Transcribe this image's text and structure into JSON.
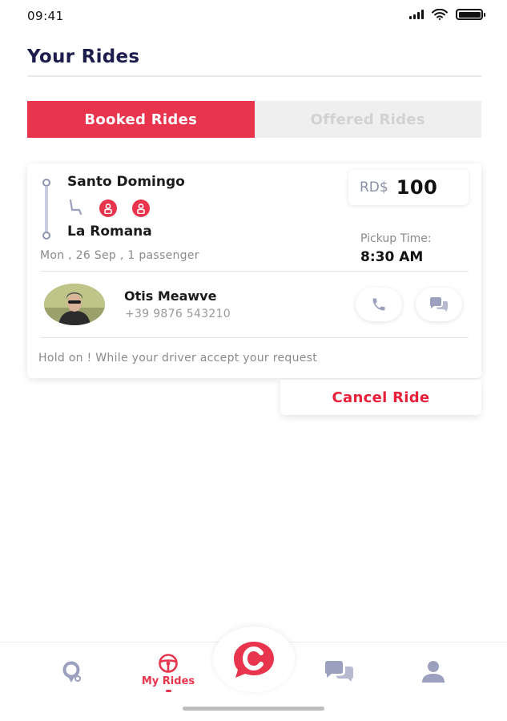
{
  "status_bar": {
    "time": "09:41"
  },
  "header": {
    "title": "Your Rides"
  },
  "tabs": [
    {
      "label": "Booked Rides",
      "active": true
    },
    {
      "label": "Offered Rides",
      "active": false
    }
  ],
  "ride": {
    "origin": "Santo Domingo",
    "destination": "La Romana",
    "currency": "RD$",
    "price": "100",
    "pickup_label": "Pickup Time:",
    "pickup_time": "8:30 AM",
    "meta": "Mon , 26 Sep , 1 passenger",
    "seats_booked": 2,
    "driver": {
      "name": "Otis Meawve",
      "phone": "+39 9876 543210"
    },
    "message": "Hold on ! While your driver accept your request",
    "cancel_label": "Cancel Ride"
  },
  "bottom_nav": {
    "items": [
      {
        "icon": "map-pin-icon",
        "label": ""
      },
      {
        "icon": "steering-wheel-icon",
        "label": "My Rides",
        "active": true
      },
      {
        "icon": "logo-c-icon",
        "label": ""
      },
      {
        "icon": "chat-bubbles-icon",
        "label": ""
      },
      {
        "icon": "user-icon",
        "label": ""
      }
    ]
  },
  "colors": {
    "accent": "#e8354d",
    "title": "#1c1d4d",
    "muted": "#8a8a8a",
    "icon_gray": "#9aa0bd"
  }
}
